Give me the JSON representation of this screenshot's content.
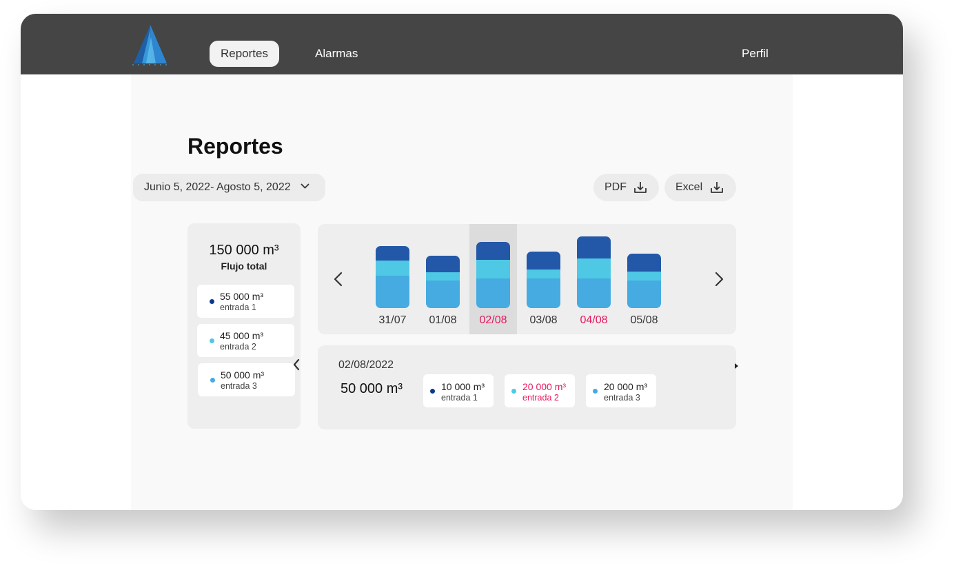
{
  "nav": {
    "tabs": [
      {
        "label": "Reportes",
        "active": true
      },
      {
        "label": "Alarmas",
        "active": false
      }
    ],
    "profile_label": "Perfil"
  },
  "page": {
    "title": "Reportes"
  },
  "filters": {
    "date_range": "Junio 5, 2022- Agosto 5, 2022"
  },
  "export": {
    "pdf_label": "PDF",
    "excel_label": "Excel"
  },
  "colors": {
    "entrada_1": "#2358a8",
    "entrada_2": "#4ec8e4",
    "entrada_3": "#45abe1",
    "dot_entrada_1": "#0b3a8c",
    "highlight": "#e8175d",
    "selected_column": "#dcdcdc"
  },
  "summary": {
    "total_value": "150 000 m³",
    "total_label": "Flujo total",
    "entries": [
      {
        "value": "55 000 m³",
        "label": "entrada 1"
      },
      {
        "value": "45 000 m³",
        "label": "entrada 2"
      },
      {
        "value": "50 000 m³",
        "label": "entrada 3"
      }
    ]
  },
  "chart_data": {
    "type": "bar",
    "stacked": true,
    "categories": [
      "31/07",
      "01/08",
      "02/08",
      "03/08",
      "04/08",
      "05/08"
    ],
    "series": [
      {
        "name": "entrada 3",
        "values": [
          47,
          40,
          43,
          43,
          43,
          40
        ]
      },
      {
        "name": "entrada 2",
        "values": [
          22,
          12,
          27,
          13,
          29,
          13
        ]
      },
      {
        "name": "entrada 1",
        "values": [
          21,
          24,
          26,
          26,
          32,
          26
        ]
      }
    ],
    "selected_category": "02/08",
    "highlighted_categories": [
      "02/08",
      "04/08"
    ]
  },
  "detail": {
    "date": "02/08/2022",
    "total": "50 000 m³",
    "entries": [
      {
        "value": "10 000 m³",
        "label": "entrada 1",
        "highlight": false
      },
      {
        "value": "20 000 m³",
        "label": "entrada 2",
        "highlight": true
      },
      {
        "value": "20 000 m³",
        "label": "entrada 3",
        "highlight": false
      }
    ]
  }
}
